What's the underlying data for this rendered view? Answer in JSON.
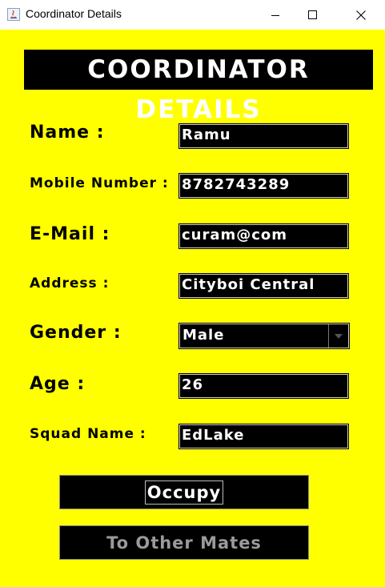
{
  "window": {
    "title": "Coordinator Details"
  },
  "form": {
    "heading": "COORDINATOR DETAILS",
    "name_label": "Name :",
    "name_value": "Ramu",
    "mobile_label": "Mobile Number :",
    "mobile_value": "8782743289",
    "email_label": "E-Mail :",
    "email_value": "curam@com",
    "address_label": "Address :",
    "address_value": "Cityboi Central",
    "gender_label": "Gender :",
    "gender_value": "Male",
    "age_label": "Age :",
    "age_value": "26",
    "squad_label": "Squad Name :",
    "squad_value": "EdLake"
  },
  "buttons": {
    "occupy": "Occupy",
    "other_mates": "To Other Mates"
  },
  "colors": {
    "background": "#ffff00",
    "field": "#000000",
    "text_light": "#ffffff",
    "disabled_text": "#9a9a9a"
  },
  "icons": [
    "java-app-icon",
    "minimize-icon",
    "maximize-icon",
    "close-icon",
    "dropdown-arrow-icon"
  ]
}
